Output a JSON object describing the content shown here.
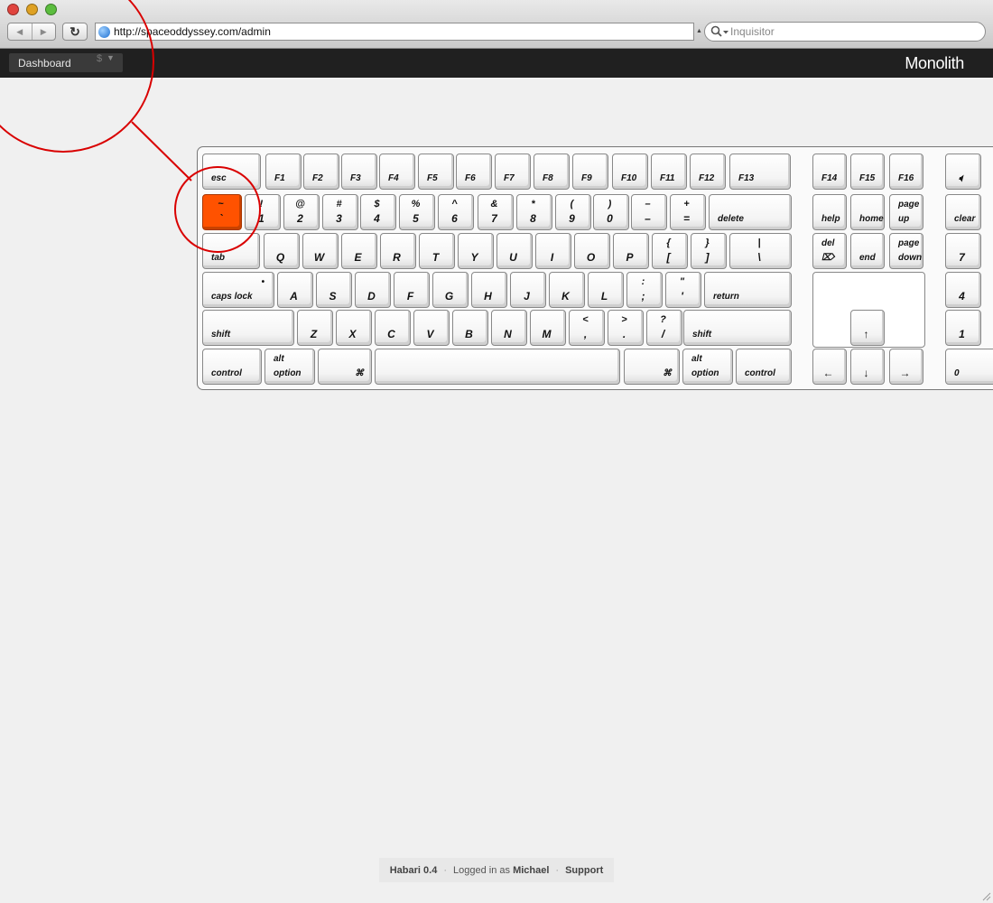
{
  "browser": {
    "url": "http://spaceoddyssey.com/admin",
    "search_placeholder": "Inquisitor",
    "back_icon": "◀",
    "forward_icon": "▶",
    "reload_icon": "↻",
    "url_dropdown_icon": "▲",
    "traffic_lights": {
      "close": "#e0443e",
      "minimize": "#dea123",
      "zoom": "#5bbd3e"
    }
  },
  "adminbar": {
    "menu_label": "Dashboard",
    "menu_handle": "$",
    "menu_arrow": "▼",
    "site_title": "Monolith"
  },
  "keyboard": {
    "highlighted_key": "tilde",
    "highlight_color": "#ff5200",
    "annotation_color": "#d90000",
    "keys": [
      {
        "id": "esc",
        "label": "esc"
      },
      {
        "id": "f1",
        "label": "F1"
      },
      {
        "id": "f2",
        "label": "F2"
      },
      {
        "id": "f3",
        "label": "F3"
      },
      {
        "id": "f4",
        "label": "F4"
      },
      {
        "id": "f5",
        "label": "F5"
      },
      {
        "id": "f6",
        "label": "F6"
      },
      {
        "id": "f7",
        "label": "F7"
      },
      {
        "id": "f8",
        "label": "F8"
      },
      {
        "id": "f9",
        "label": "F9"
      },
      {
        "id": "f10",
        "label": "F10"
      },
      {
        "id": "f11",
        "label": "F11"
      },
      {
        "id": "f12",
        "label": "F12"
      },
      {
        "id": "f13",
        "label": "F13"
      },
      {
        "id": "f14",
        "label": "F14"
      },
      {
        "id": "f15",
        "label": "F15"
      },
      {
        "id": "f16",
        "label": "F16"
      },
      {
        "id": "mute",
        "label": "🔈︎"
      },
      {
        "id": "tilde",
        "top": "~",
        "label": "`"
      },
      {
        "id": "1",
        "top": "!",
        "label": "1"
      },
      {
        "id": "2",
        "top": "@",
        "label": "2"
      },
      {
        "id": "3",
        "top": "#",
        "label": "3"
      },
      {
        "id": "4",
        "top": "$",
        "label": "4"
      },
      {
        "id": "5",
        "top": "%",
        "label": "5"
      },
      {
        "id": "6",
        "top": "^",
        "label": "6"
      },
      {
        "id": "7",
        "top": "&",
        "label": "7"
      },
      {
        "id": "8",
        "top": "*",
        "label": "8"
      },
      {
        "id": "9",
        "top": "(",
        "label": "9"
      },
      {
        "id": "0",
        "top": ")",
        "label": "0"
      },
      {
        "id": "minus",
        "top": "–",
        "label": "–"
      },
      {
        "id": "equal",
        "top": "+",
        "label": "="
      },
      {
        "id": "delete",
        "label": "delete"
      },
      {
        "id": "help",
        "label": "help"
      },
      {
        "id": "home",
        "label": "home"
      },
      {
        "id": "pageup",
        "top": "page",
        "label": "up"
      },
      {
        "id": "clear",
        "label": "clear"
      },
      {
        "id": "tab",
        "label": "tab"
      },
      {
        "id": "q",
        "label": "Q"
      },
      {
        "id": "w",
        "label": "W"
      },
      {
        "id": "e",
        "label": "E"
      },
      {
        "id": "r",
        "label": "R"
      },
      {
        "id": "t",
        "label": "T"
      },
      {
        "id": "y",
        "label": "Y"
      },
      {
        "id": "u",
        "label": "U"
      },
      {
        "id": "i",
        "label": "I"
      },
      {
        "id": "o",
        "label": "O"
      },
      {
        "id": "p",
        "label": "P"
      },
      {
        "id": "lbracket",
        "top": "{",
        "label": "["
      },
      {
        "id": "rbracket",
        "top": "}",
        "label": "]"
      },
      {
        "id": "backslash",
        "top": "|",
        "label": "\\"
      },
      {
        "id": "fwddel",
        "top": "del",
        "label": "⌦"
      },
      {
        "id": "end",
        "label": "end"
      },
      {
        "id": "pagedown",
        "top": "page",
        "label": "down"
      },
      {
        "id": "kp7",
        "label": "7"
      },
      {
        "id": "capslock",
        "top": "•",
        "label": "caps lock"
      },
      {
        "id": "a",
        "label": "A"
      },
      {
        "id": "s",
        "label": "S"
      },
      {
        "id": "d",
        "label": "D"
      },
      {
        "id": "f",
        "label": "F"
      },
      {
        "id": "g",
        "label": "G"
      },
      {
        "id": "h",
        "label": "H"
      },
      {
        "id": "j",
        "label": "J"
      },
      {
        "id": "k",
        "label": "K"
      },
      {
        "id": "l",
        "label": "L"
      },
      {
        "id": "semicolon",
        "top": ":",
        "label": ";"
      },
      {
        "id": "quote",
        "top": "\"",
        "label": "'"
      },
      {
        "id": "return",
        "label": "return"
      },
      {
        "id": "kp4",
        "label": "4"
      },
      {
        "id": "lshift",
        "label": "shift"
      },
      {
        "id": "z",
        "label": "Z"
      },
      {
        "id": "x",
        "label": "X"
      },
      {
        "id": "c",
        "label": "C"
      },
      {
        "id": "v",
        "label": "V"
      },
      {
        "id": "b",
        "label": "B"
      },
      {
        "id": "n",
        "label": "N"
      },
      {
        "id": "m",
        "label": "M"
      },
      {
        "id": "comma",
        "top": "<",
        "label": ","
      },
      {
        "id": "period",
        "top": ">",
        "label": "."
      },
      {
        "id": "slash",
        "top": "?",
        "label": "/"
      },
      {
        "id": "rshift",
        "label": "shift"
      },
      {
        "id": "up",
        "label": "↑"
      },
      {
        "id": "kp1",
        "label": "1"
      },
      {
        "id": "lcontrol",
        "label": "control"
      },
      {
        "id": "loption",
        "top": "alt",
        "label": "option"
      },
      {
        "id": "lcommand",
        "label": "⌘",
        "apple": ""
      },
      {
        "id": "space",
        "label": ""
      },
      {
        "id": "rcommand",
        "label": "⌘",
        "apple": ""
      },
      {
        "id": "roption",
        "top": "alt",
        "label": "option"
      },
      {
        "id": "rcontrol",
        "label": "control"
      },
      {
        "id": "left",
        "label": "←"
      },
      {
        "id": "down",
        "label": "↓"
      },
      {
        "id": "right",
        "label": "→"
      },
      {
        "id": "kp0",
        "label": "0"
      }
    ]
  },
  "footer": {
    "app": "Habari 0.4",
    "logged_in_prefix": "Logged in as",
    "user": "Michael",
    "support": "Support",
    "separator": "·"
  }
}
